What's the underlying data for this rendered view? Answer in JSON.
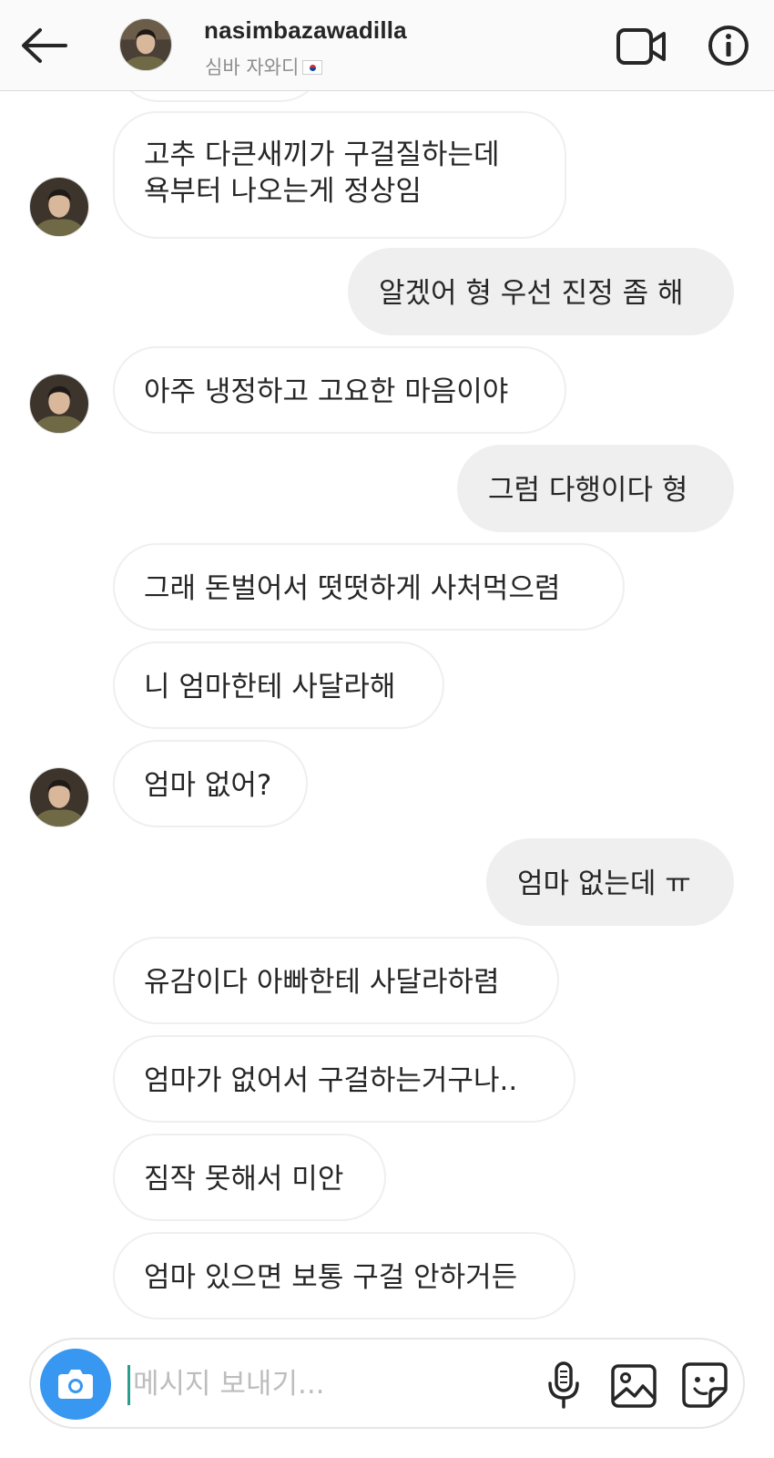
{
  "header": {
    "username": "nasimbazawadilla",
    "display_name": "심바 자와디",
    "flag_icon": "south-korea-flag-icon"
  },
  "messages": [
    {
      "side": "in",
      "lines": [
        "고추 다큰새끼가 구걸질하는데",
        "욕부터 나오는게 정상임"
      ],
      "avatar": true
    },
    {
      "side": "out",
      "lines": [
        "알겠어 형 우선 진정 좀 해"
      ],
      "avatar": false
    },
    {
      "side": "in",
      "lines": [
        "아주 냉정하고 고요한 마음이야"
      ],
      "avatar": true
    },
    {
      "side": "out",
      "lines": [
        "그럼 다행이다 형"
      ],
      "avatar": false
    },
    {
      "side": "in",
      "lines": [
        "그래 돈벌어서 떳떳하게 사처먹으렴"
      ],
      "avatar": false
    },
    {
      "side": "in",
      "lines": [
        "니 엄마한테 사달라해"
      ],
      "avatar": false
    },
    {
      "side": "in",
      "lines": [
        "엄마 없어?"
      ],
      "avatar": true
    },
    {
      "side": "out",
      "lines": [
        "엄마 없는데 ㅠ"
      ],
      "avatar": false
    },
    {
      "side": "in",
      "lines": [
        "유감이다 아빠한테 사달라하렴"
      ],
      "avatar": false
    },
    {
      "side": "in",
      "lines": [
        "엄마가 없어서 구걸하는거구나.."
      ],
      "avatar": false
    },
    {
      "side": "in",
      "lines": [
        "짐작 못해서 미안"
      ],
      "avatar": false
    },
    {
      "side": "in",
      "lines": [
        "엄마 있으면 보통 구걸 안하거든"
      ],
      "avatar": false
    }
  ],
  "composer": {
    "placeholder": "메시지 보내기..."
  },
  "colors": {
    "accent": "#3897f0",
    "outgoing_bubble": "#efefef",
    "incoming_border": "#efefef",
    "header_bg": "#fafafa",
    "secondary_text": "#8e8e8e"
  },
  "icons": [
    "back-arrow-icon",
    "video-call-icon",
    "info-icon",
    "camera-icon",
    "microphone-icon",
    "gallery-icon",
    "sticker-icon"
  ]
}
